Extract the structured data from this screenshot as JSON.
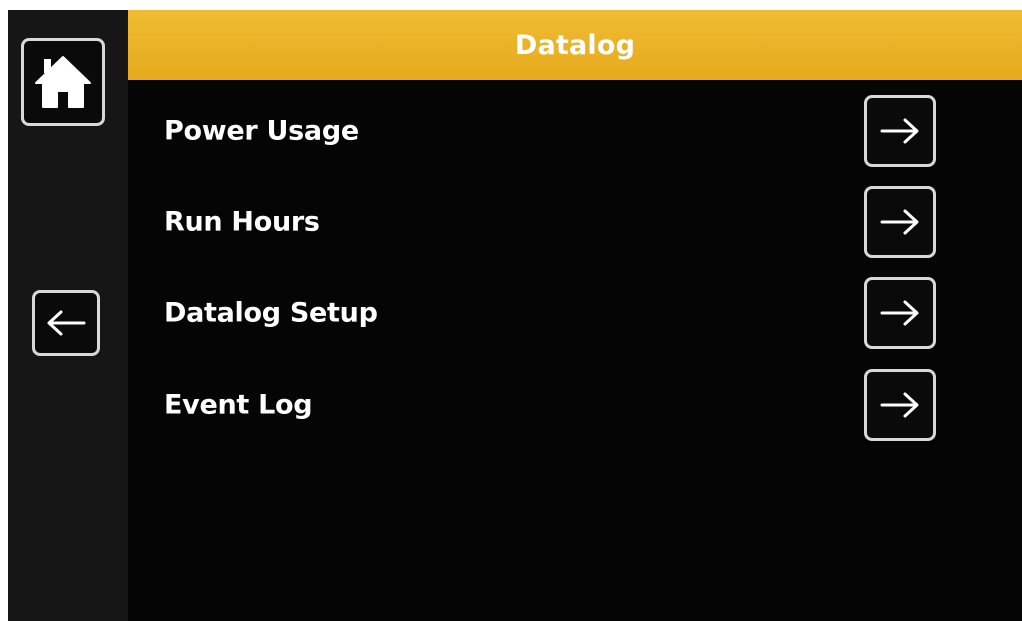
{
  "header": {
    "title": "Datalog"
  },
  "sidebar": {
    "home_icon": "home-icon",
    "back_icon": "arrow-left-icon"
  },
  "menu": {
    "items": [
      {
        "label": "Power Usage",
        "icon": "arrow-right-icon"
      },
      {
        "label": "Run Hours",
        "icon": "arrow-right-icon"
      },
      {
        "label": "Datalog Setup",
        "icon": "arrow-right-icon"
      },
      {
        "label": "Event Log",
        "icon": "arrow-right-icon"
      }
    ]
  },
  "colors": {
    "header_bg": "#e9b125",
    "screen_bg": "#050505",
    "sidebar_bg": "#161616",
    "text": "#ffffff",
    "button_border": "#d8d8d8"
  }
}
